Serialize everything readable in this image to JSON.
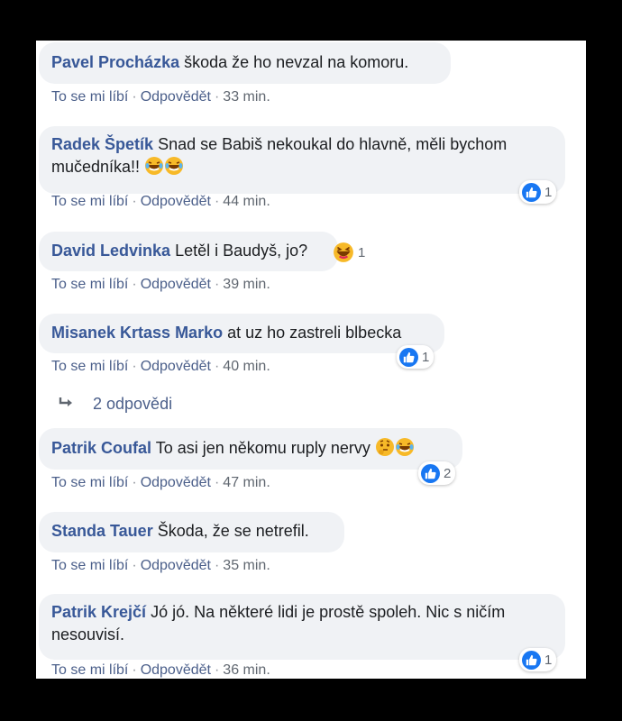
{
  "actions": {
    "like": "To se mi líbí",
    "reply": "Odpovědět",
    "sep": "·"
  },
  "comments": [
    {
      "author": "Pavel Procházka",
      "text": "škoda že ho nevzal na komoru.",
      "time": "33 min."
    },
    {
      "author": "Radek Špetík",
      "text": "Snad se Babiš nekoukal do hlavně, měli bychom mučedníka!!",
      "time": "44 min.",
      "reaction_count": "1",
      "reaction_icon": "like-icon",
      "emoji": [
        "laugh-cry-emoji",
        "laugh-cry-emoji"
      ]
    },
    {
      "author": "David Ledvinka",
      "text": "Letěl i Baudyš, jo?",
      "time": "39 min.",
      "reaction_count": "1",
      "reaction_icon": "haha-icon"
    },
    {
      "author": "Misanek Krtass Marko",
      "text": "at uz ho zastreli blbecka",
      "time": "40 min.",
      "reaction_count": "1",
      "reaction_icon": "like-icon"
    },
    {
      "author": "Patrik Coufal",
      "text": "To asi jen někomu ruply nervy",
      "time": "47 min.",
      "reaction_count": "2",
      "reaction_icon": "like-icon",
      "emoji": [
        "thinking-emoji",
        "laugh-cry-emoji"
      ]
    },
    {
      "author": "Standa Tauer",
      "text": "Škoda, že se netrefil.",
      "time": "35 min."
    },
    {
      "author": "Patrik Krejčí",
      "text": "Jó jó. Na některé lidi je prostě spoleh. Nic s ničím nesouvisí.",
      "time": "36 min.",
      "reaction_count": "1",
      "reaction_icon": "like-icon"
    }
  ],
  "replies": {
    "label": "2 odpovědi",
    "icon": "reply-arrow-icon"
  },
  "colors": {
    "author": "#385898",
    "bubble": "#f0f2f5",
    "like": "#1877f2",
    "link": "#4b5f8a"
  }
}
